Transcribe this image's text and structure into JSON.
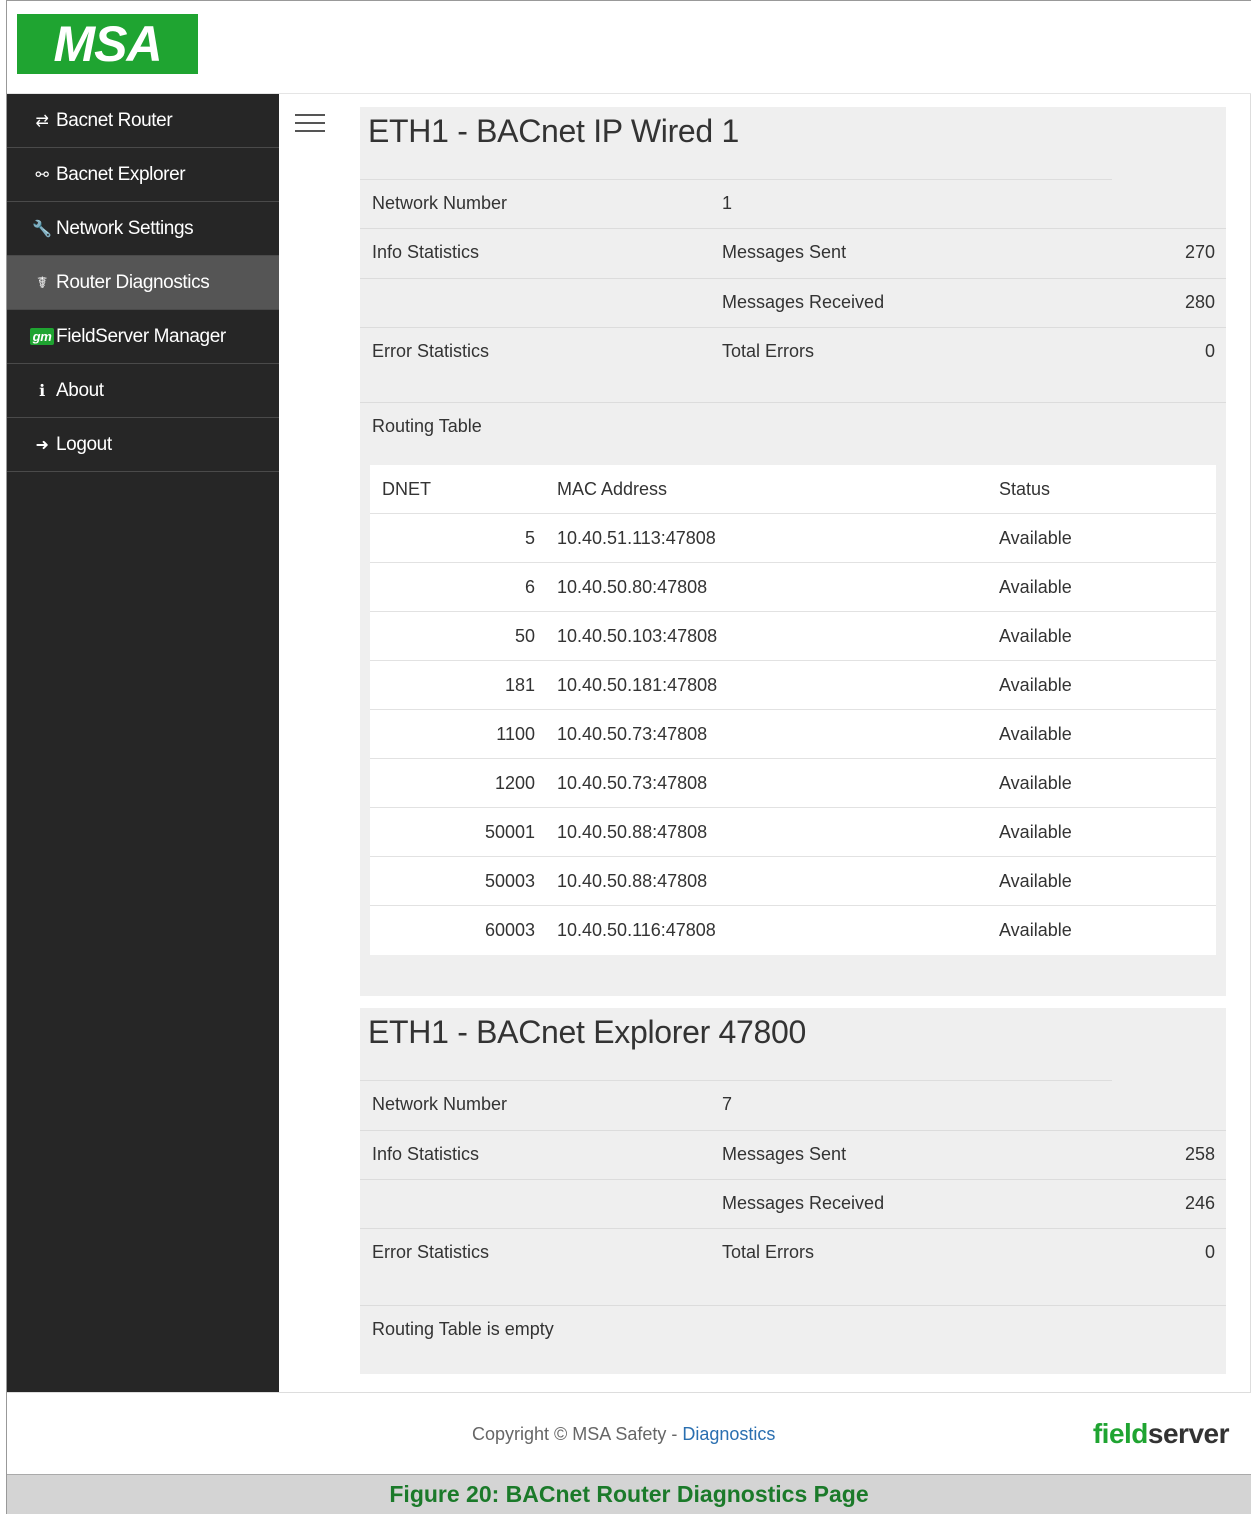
{
  "brand": {
    "logo_text": "MSA",
    "footer_logo_part1": "field",
    "footer_logo_part2": "server"
  },
  "sidebar": {
    "items": [
      {
        "label": "Bacnet Router",
        "icon": "exchange-icon",
        "glyph": "⇄"
      },
      {
        "label": "Bacnet Explorer",
        "icon": "sitemap-icon",
        "glyph": "⚯"
      },
      {
        "label": "Network Settings",
        "icon": "wrench-icon",
        "glyph": "🔧"
      },
      {
        "label": "Router Diagnostics",
        "icon": "stethoscope-icon",
        "glyph": "☤"
      },
      {
        "label": "FieldServer Manager",
        "icon": "gt-icon",
        "glyph": "gт"
      },
      {
        "label": "About",
        "icon": "info-icon",
        "glyph": "ℹ"
      },
      {
        "label": "Logout",
        "icon": "sign-out-icon",
        "glyph": "➜"
      }
    ],
    "active_index": 3
  },
  "panels": [
    {
      "title": "ETH1 - BACnet IP Wired 1",
      "network_number_label": "Network Number",
      "network_number": "1",
      "info_label": "Info Statistics",
      "sent_label": "Messages Sent",
      "sent": "270",
      "received_label": "Messages Received",
      "received": "280",
      "error_label": "Error Statistics",
      "total_errors_label": "Total Errors",
      "total_errors": "0",
      "routing_label": "Routing Table",
      "routing_headers": {
        "dnet": "DNET",
        "mac": "MAC Address",
        "status": "Status"
      },
      "routing_rows": [
        {
          "dnet": "5",
          "mac": "10.40.51.113:47808",
          "status": "Available"
        },
        {
          "dnet": "6",
          "mac": "10.40.50.80:47808",
          "status": "Available"
        },
        {
          "dnet": "50",
          "mac": "10.40.50.103:47808",
          "status": "Available"
        },
        {
          "dnet": "181",
          "mac": "10.40.50.181:47808",
          "status": "Available"
        },
        {
          "dnet": "1100",
          "mac": "10.40.50.73:47808",
          "status": "Available"
        },
        {
          "dnet": "1200",
          "mac": "10.40.50.73:47808",
          "status": "Available"
        },
        {
          "dnet": "50001",
          "mac": "10.40.50.88:47808",
          "status": "Available"
        },
        {
          "dnet": "50003",
          "mac": "10.40.50.88:47808",
          "status": "Available"
        },
        {
          "dnet": "60003",
          "mac": "10.40.50.116:47808",
          "status": "Available"
        }
      ]
    },
    {
      "title": "ETH1 - BACnet Explorer 47800",
      "network_number_label": "Network Number",
      "network_number": "7",
      "info_label": "Info Statistics",
      "sent_label": "Messages Sent",
      "sent": "258",
      "received_label": "Messages Received",
      "received": "246",
      "error_label": "Error Statistics",
      "total_errors_label": "Total Errors",
      "total_errors": "0",
      "routing_empty": "Routing Table is empty"
    }
  ],
  "footer": {
    "copyright": "Copyright © MSA Safety - ",
    "link": "Diagnostics"
  },
  "caption": "Figure 20: BACnet Router Diagnostics Page"
}
